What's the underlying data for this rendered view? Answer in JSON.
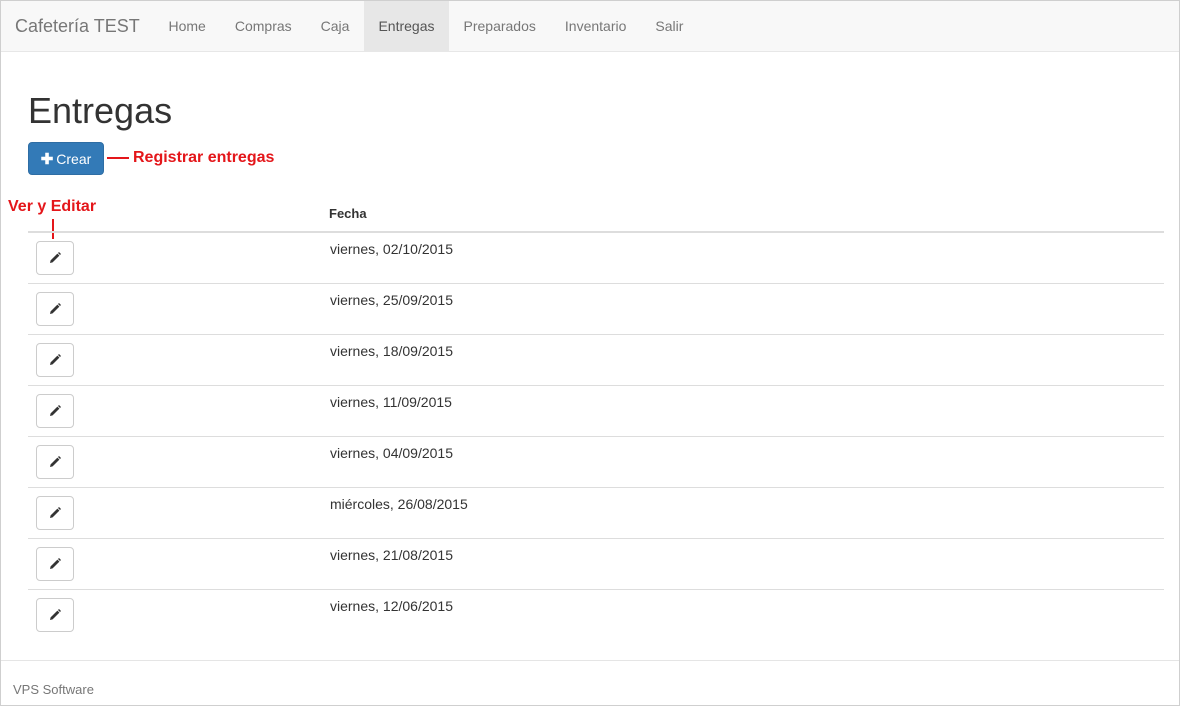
{
  "navbar": {
    "brand": "Cafetería TEST",
    "items": [
      {
        "label": "Home",
        "active": false
      },
      {
        "label": "Compras",
        "active": false
      },
      {
        "label": "Caja",
        "active": false
      },
      {
        "label": "Entregas",
        "active": true
      },
      {
        "label": "Preparados",
        "active": false
      },
      {
        "label": "Inventario",
        "active": false
      },
      {
        "label": "Salir",
        "active": false
      }
    ]
  },
  "page": {
    "title": "Entregas",
    "create_label": "Crear",
    "create_icon": "plus-icon"
  },
  "annotations": {
    "create": "Registrar entregas",
    "edit": "Ver y Editar",
    "color": "#e4161a"
  },
  "table": {
    "header": {
      "fecha": "Fecha"
    },
    "edit_icon": "pencil-icon",
    "rows": [
      {
        "fecha": "viernes, 02/10/2015"
      },
      {
        "fecha": "viernes, 25/09/2015"
      },
      {
        "fecha": "viernes, 18/09/2015"
      },
      {
        "fecha": "viernes, 11/09/2015"
      },
      {
        "fecha": "viernes, 04/09/2015"
      },
      {
        "fecha": "miércoles, 26/08/2015"
      },
      {
        "fecha": "viernes, 21/08/2015"
      },
      {
        "fecha": "viernes, 12/06/2015"
      }
    ]
  },
  "footer": {
    "text": "VPS Software"
  },
  "colors": {
    "primary": "#337ab7",
    "navbar_bg": "#f8f8f8",
    "nav_active_bg": "#e7e7e7"
  }
}
